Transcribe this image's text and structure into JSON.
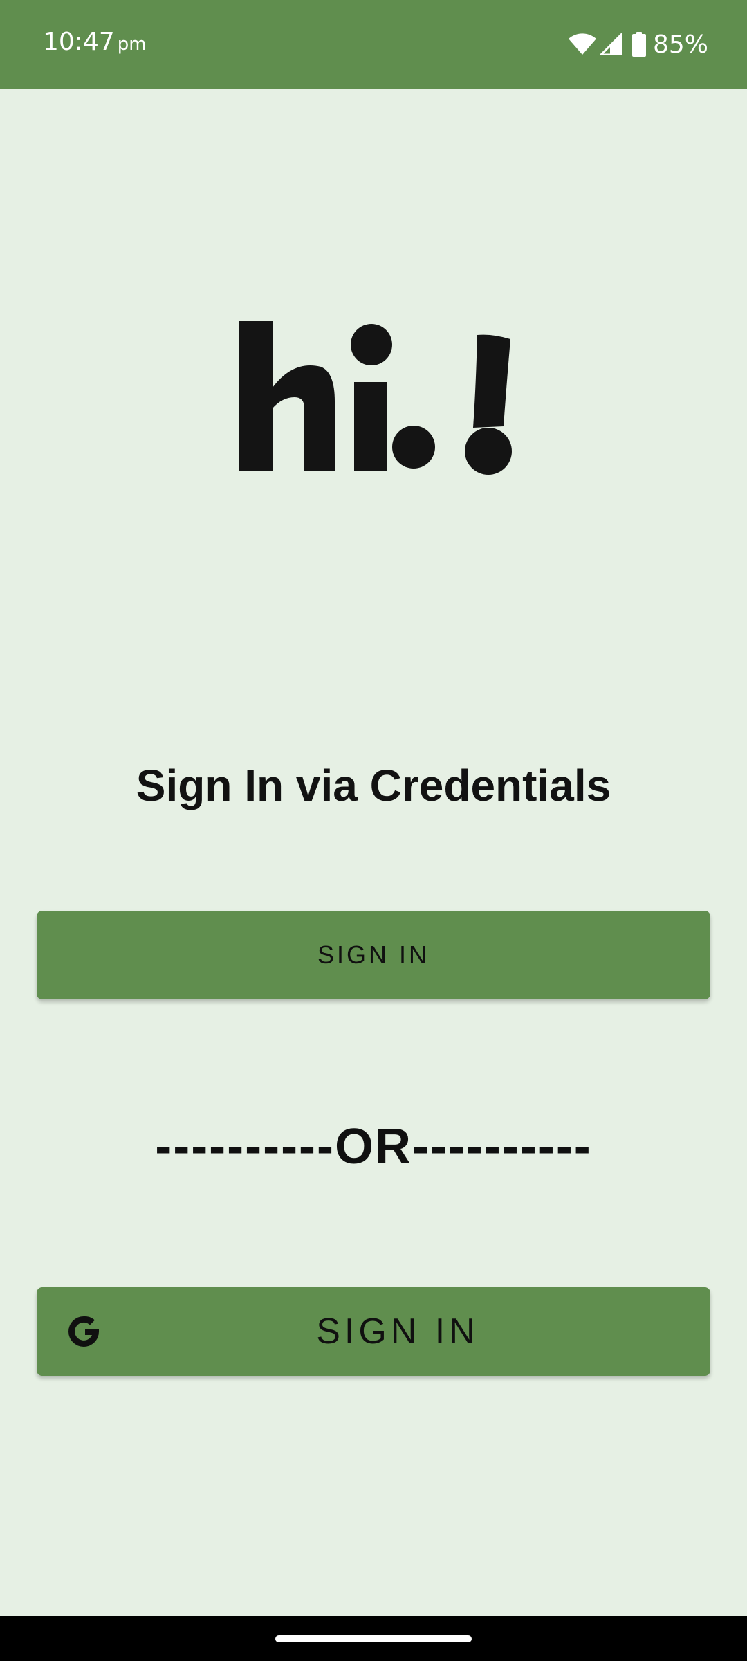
{
  "status_bar": {
    "time": "10:47",
    "ampm": "pm",
    "battery_percent": "85%",
    "icons": [
      "wifi-icon",
      "signal-icon",
      "battery-icon"
    ]
  },
  "logo": {
    "text": "hi.!"
  },
  "heading": "Sign In via Credentials",
  "credentials_button": {
    "label": "SIGN IN"
  },
  "divider": "----------OR----------",
  "google_button": {
    "label": "SIGN IN",
    "icon": "google-icon"
  },
  "colors": {
    "primary": "#608e4e",
    "background": "#e6f0e4",
    "text": "#121212",
    "nav_bar": "#000000"
  }
}
